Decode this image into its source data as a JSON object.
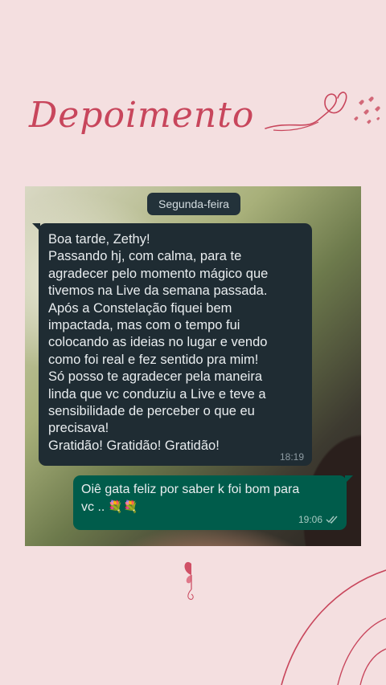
{
  "header": {
    "title": "Depoimento"
  },
  "chat": {
    "date_label": "Segunda-feira",
    "incoming": {
      "lines": [
        "Boa tarde, Zethy!",
        "Passando hj, com calma, para te",
        "agradecer pelo momento mágico que",
        "tivemos na Live da semana passada.",
        "Após a Constelação fiquei bem",
        "impactada, mas com o tempo fui",
        "colocando as ideias no lugar e vendo",
        "como foi real e fez sentido pra mim!",
        "Só posso te agradecer pela maneira",
        "linda que vc conduziu a Live e teve a",
        "sensibilidade de perceber o que eu",
        "precisava!",
        "Gratidão! Gratidão! Gratidão!"
      ],
      "time": "18:19"
    },
    "outgoing": {
      "line1": "Oiê gata feliz por saber k foi bom para",
      "line2": "vc ..",
      "emoji": "💐💐",
      "time": "19:06",
      "status_icon": "double-check-icon"
    }
  },
  "colors": {
    "background": "#f4dfe0",
    "accent": "#c8465c",
    "incoming_bubble": "#1f2c33",
    "outgoing_bubble": "#005c4b"
  }
}
